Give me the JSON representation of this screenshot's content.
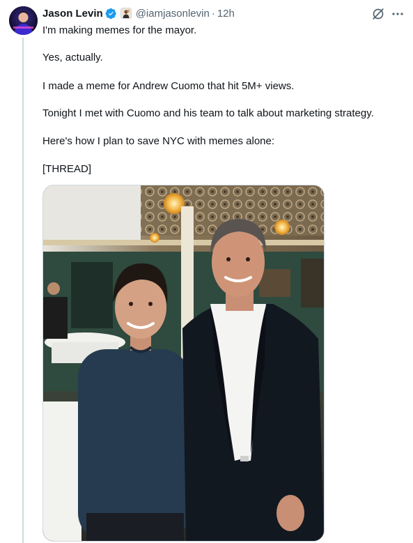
{
  "author": {
    "name": "Jason Levin",
    "handle": "@iamjasonlevin",
    "separator": "·",
    "time": "12h"
  },
  "icons": {
    "verified": "verified-badge-icon",
    "affiliate": "affiliate-badge-icon",
    "grok": "grok-icon",
    "more": "more-options-icon",
    "verified_color": "#1d9bf0"
  },
  "tweet": {
    "lines": [
      "I'm making memes for the mayor.",
      "Yes, actually.",
      "I made a meme for Andrew Cuomo that hit 5M+ views.",
      "Tonight I met with Cuomo and his team to talk about marketing strategy.",
      "Here's how I plan to save NYC with memes alone:",
      "[THREAD]"
    ]
  },
  "media": {
    "type": "photo"
  }
}
